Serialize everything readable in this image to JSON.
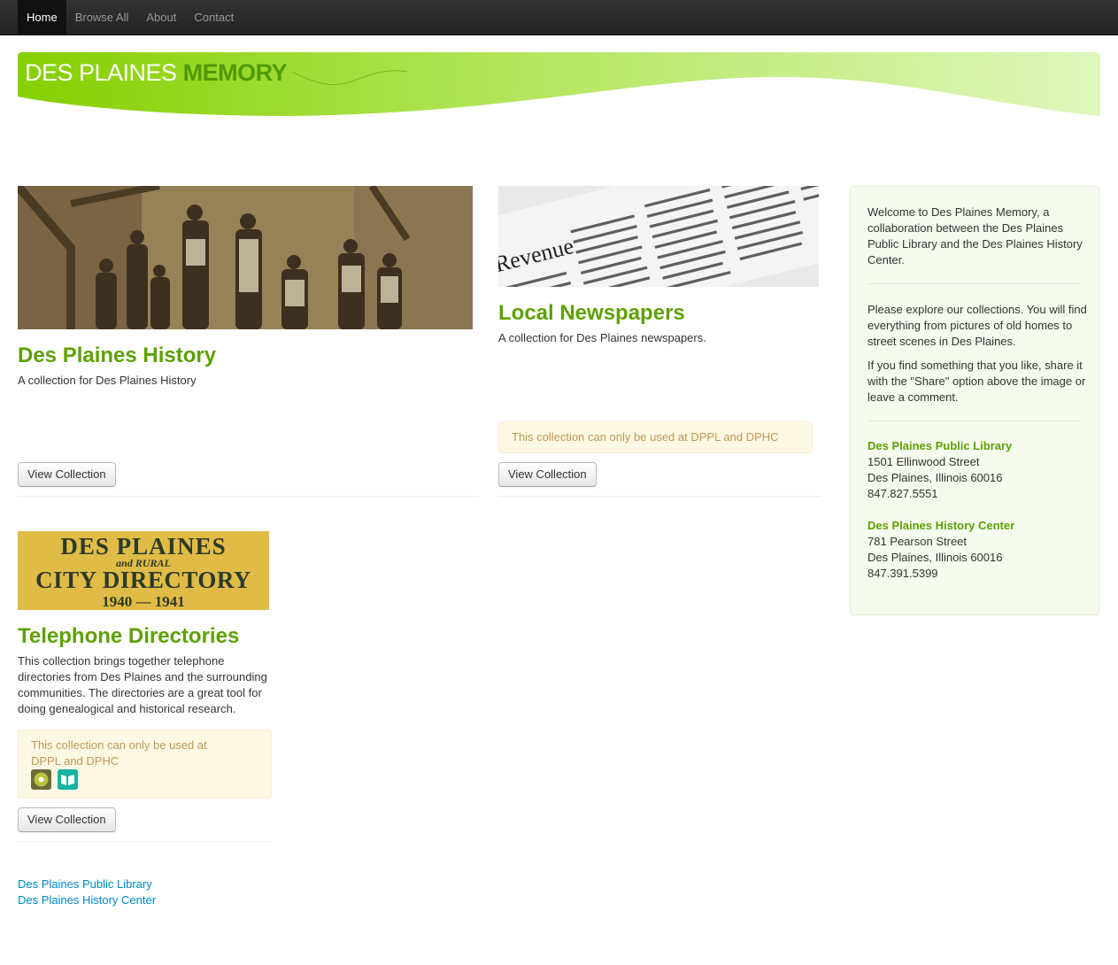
{
  "nav": {
    "items": [
      {
        "label": "Home",
        "active": true
      },
      {
        "label": "Browse All",
        "active": false
      },
      {
        "label": "About",
        "active": false
      },
      {
        "label": "Contact",
        "active": false
      }
    ]
  },
  "banner": {
    "title_light": "DES PLAINES ",
    "title_strong": "MEMORY",
    "colors": {
      "green_start": "#8fd400",
      "green_end": "#d4f5a6",
      "accent": "#4e9a06"
    }
  },
  "collections": [
    {
      "title": "Des Plaines History",
      "description": "A collection for Des Plaines History",
      "button": "View Collection",
      "image": "sepia-photo-workers"
    },
    {
      "title": "Local Newspapers",
      "description": "A collection for Des Plaines newspapers.",
      "alert": "This collection can only be used at DPPL and DPHC",
      "button": "View Collection",
      "image": "newspaper-clipping",
      "image_text": "Revenue"
    },
    {
      "title": "Telephone Directories",
      "description": "This collection brings together telephone directories from Des Plaines and the surrounding communities. The directories are a great tool for doing genealogical and historical research.",
      "alert": "This collection can only be used at DPPL and DPHC",
      "button": "View Collection",
      "image": "directory-cover",
      "image_lines": [
        "DES PLAINES",
        "and RURAL",
        "CITY DIRECTORY",
        "1940 — 1941"
      ],
      "icons": [
        "dppl-logo-icon",
        "dphc-logo-icon"
      ]
    }
  ],
  "sidebar": {
    "welcome": "Welcome to Des Plaines Memory, a collaboration between the Des Plaines Public Library and the Des Plaines History Center.",
    "explore": "Please explore our collections. You will find everything from pictures of old homes to street scenes in Des Plaines.",
    "share": "If you find something that you like, share it with the \"Share\" option above the image or leave a comment.",
    "library": {
      "name": "Des Plaines Public Library",
      "street": "1501 Ellinwood Street",
      "city": "Des Plaines, Illinois 60016",
      "phone": "847.827.5551"
    },
    "history_center": {
      "name": "Des Plaines History Center",
      "street": "781 Pearson Street",
      "city": "Des Plaines, Illinois 60016",
      "phone": "847.391.5399"
    }
  },
  "footer": {
    "links": [
      "Des Plaines Public Library",
      "Des Plaines History Center"
    ]
  }
}
